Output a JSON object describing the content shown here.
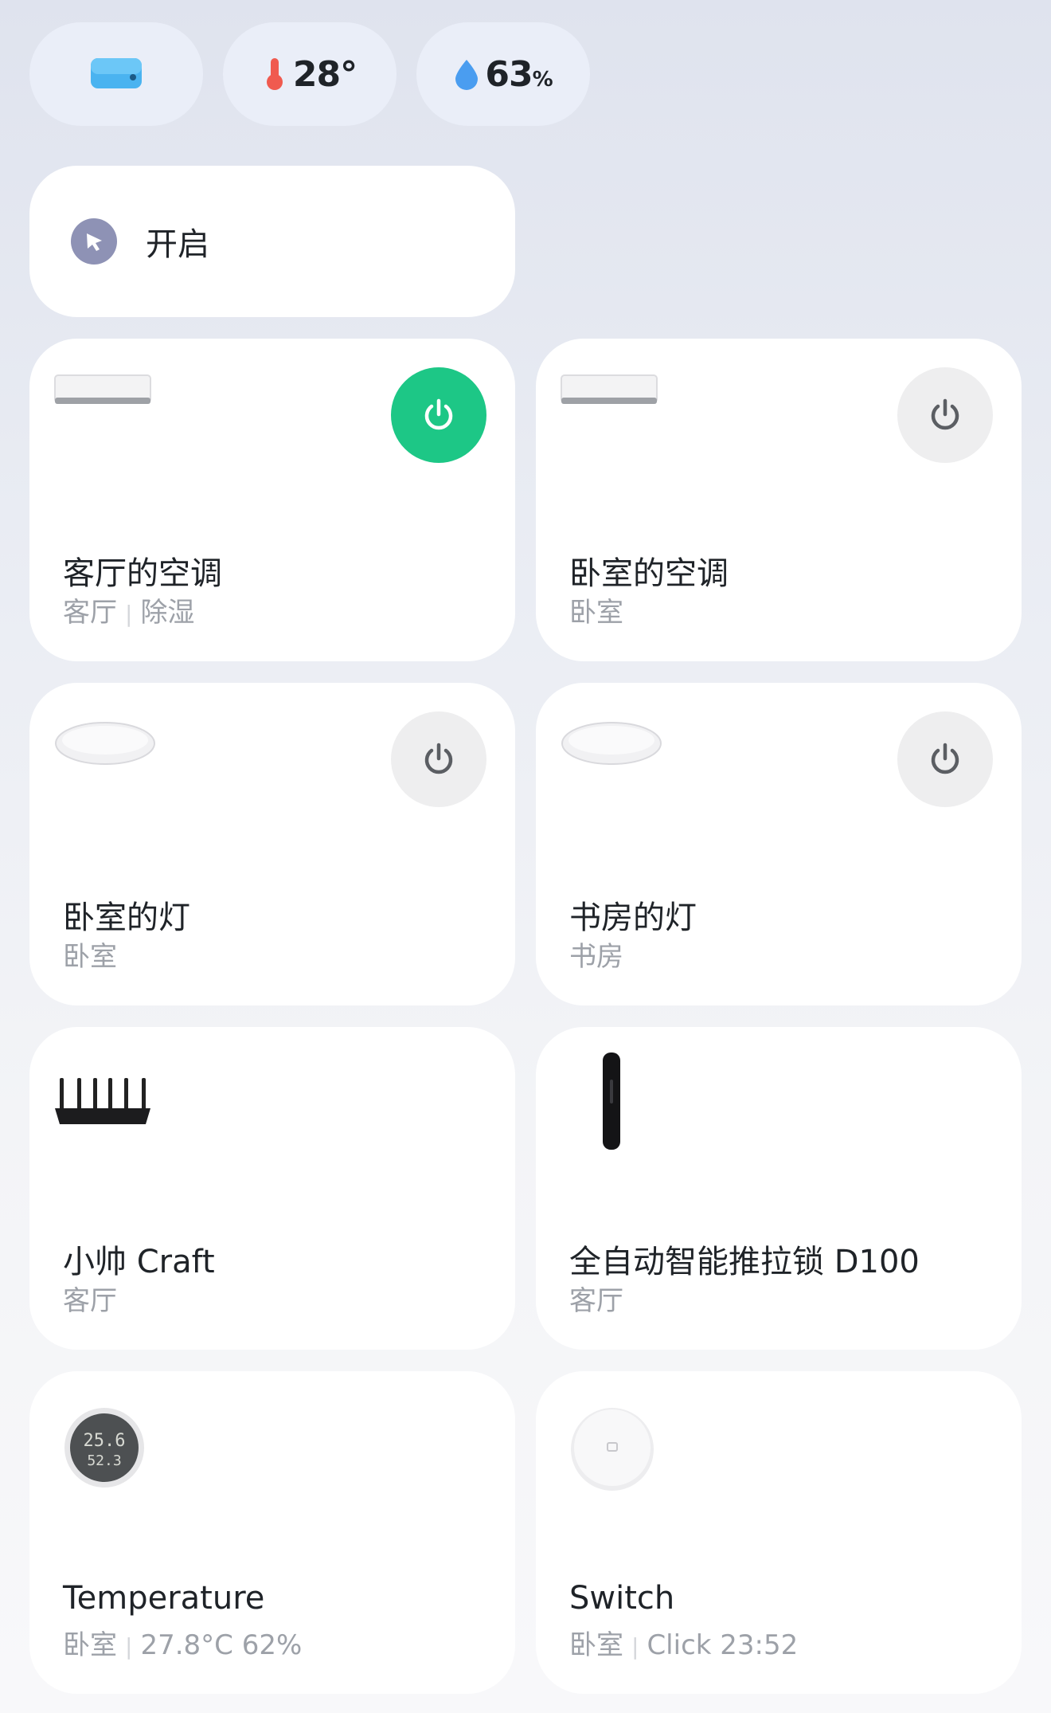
{
  "status_bar": {
    "temperature": "28°",
    "humidity_value": "63",
    "humidity_unit": "%"
  },
  "scene": {
    "label": "开启"
  },
  "devices": [
    {
      "name": "客厅的空调",
      "room": "客厅",
      "status": "除湿",
      "power_on": true,
      "icon": "air-conditioner-icon"
    },
    {
      "name": "卧室的空调",
      "room": "卧室",
      "status": "",
      "power_on": false,
      "icon": "air-conditioner-icon"
    },
    {
      "name": "卧室的灯",
      "room": "卧室",
      "status": "",
      "power_on": false,
      "icon": "ceiling-light-icon"
    },
    {
      "name": "书房的灯",
      "room": "书房",
      "status": "",
      "power_on": false,
      "icon": "ceiling-light-icon"
    },
    {
      "name": "小帅 Craft",
      "room": "客厅",
      "status": "",
      "icon": "router-icon"
    },
    {
      "name": "全自动智能推拉锁 D100",
      "room": "客厅",
      "status": "",
      "icon": "smart-lock-icon"
    },
    {
      "name": "Temperature",
      "room": "卧室",
      "status": "27.8°C 62%",
      "icon": "thermometer-sensor-icon",
      "display_temp": "25.6",
      "display_hum": "52.3"
    },
    {
      "name": "Switch",
      "room": "卧室",
      "status": "Click 23:52",
      "icon": "wireless-switch-icon"
    }
  ],
  "colors": {
    "power_on": "#1dc786",
    "power_off": "#eeeeef",
    "scene_icon": "#8e92b5",
    "thermometer": "#f05a4f",
    "droplet": "#4a9df0"
  }
}
